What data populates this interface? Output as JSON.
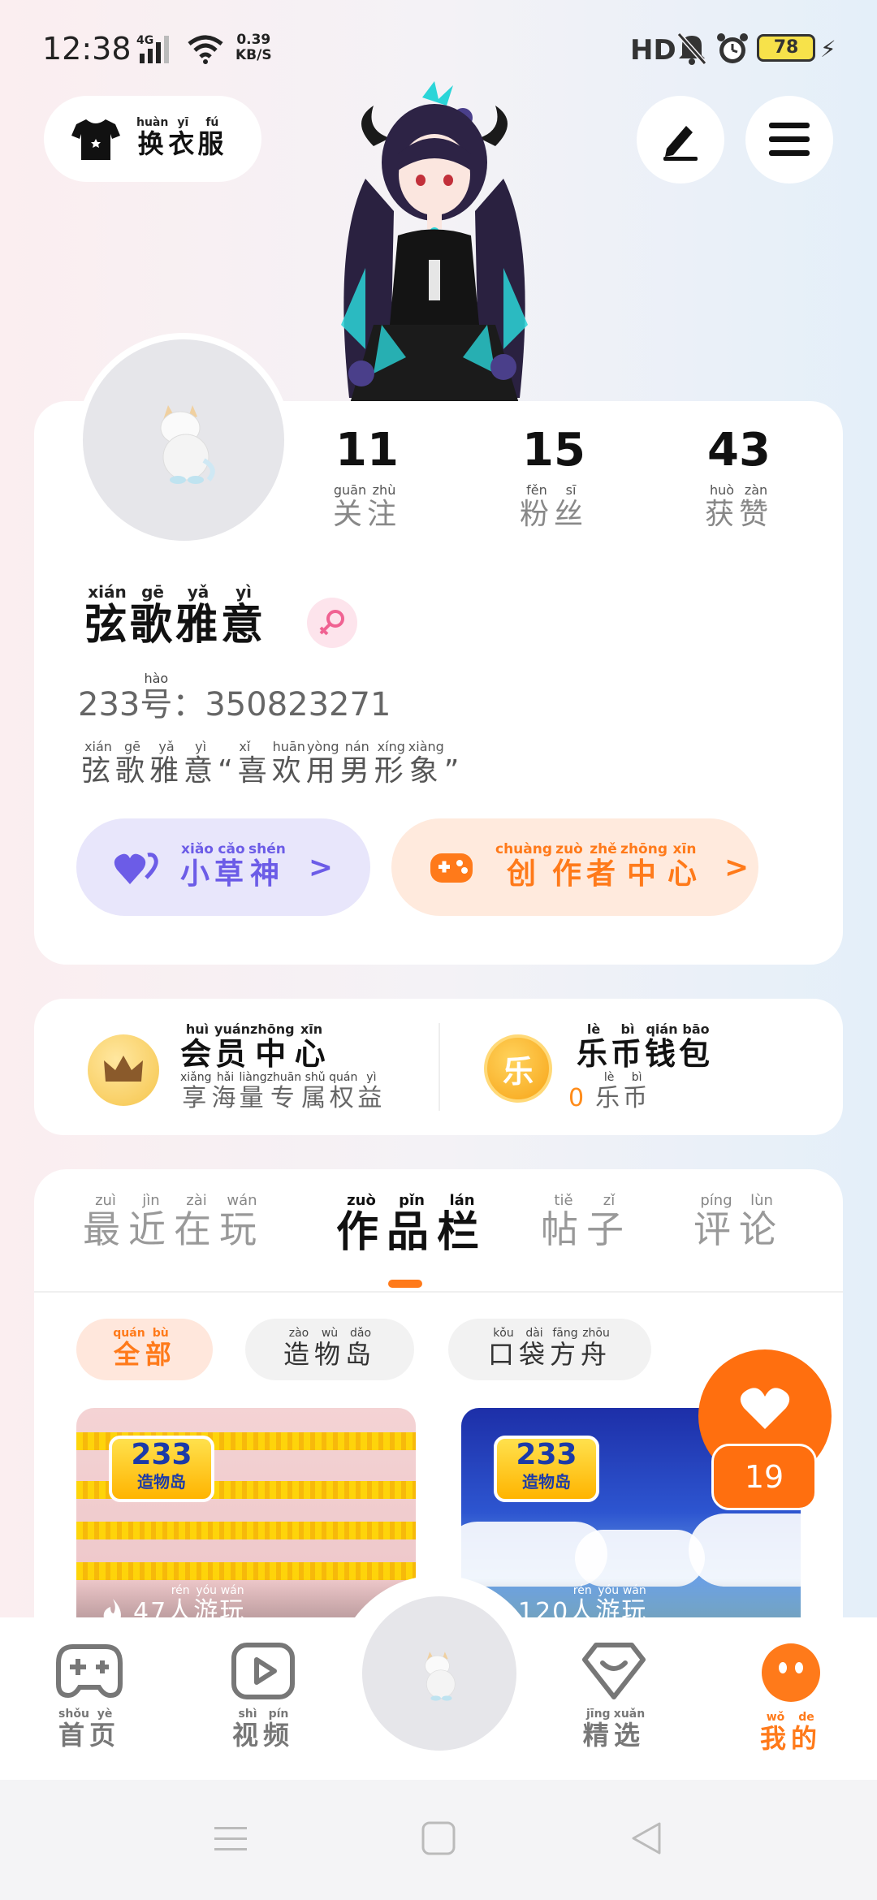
{
  "status_bar": {
    "time": "12:38",
    "network": "4G",
    "speed_value": "0.39",
    "speed_unit": "KB/S",
    "hd": "HD",
    "battery": "78"
  },
  "top": {
    "dress_label": "换衣服",
    "dress_pinyin": [
      "huàn",
      "yī",
      "fú"
    ]
  },
  "profile": {
    "stats": [
      {
        "value": "11",
        "label": [
          "关",
          "注"
        ],
        "pinyin": [
          "guān",
          "zhù"
        ]
      },
      {
        "value": "15",
        "label": [
          "粉",
          "丝"
        ],
        "pinyin": [
          "fěn",
          "sī"
        ]
      },
      {
        "value": "43",
        "label": [
          "获",
          "赞"
        ],
        "pinyin": [
          "huò",
          "zàn"
        ]
      }
    ],
    "username_chars": [
      "弦",
      "歌",
      "雅",
      "意"
    ],
    "username_pinyin": [
      "xián",
      "gē",
      "yǎ",
      "yì"
    ],
    "uid_prefix": "233",
    "uid_hao": "号",
    "uid_hao_pinyin": "hào",
    "uid_sep": "：",
    "uid_value": "350823271",
    "bio_chars": [
      "弦",
      "歌",
      "雅",
      "意",
      "“喜",
      "欢",
      "用",
      "男",
      "形",
      "象",
      "”"
    ],
    "bio_pinyin": [
      "xián",
      "gē",
      "yǎ",
      "yì",
      "xǐ",
      "huān",
      "yòng",
      "nán",
      "xíng",
      "xiàng",
      ""
    ],
    "btn_xzs": [
      "小",
      "草",
      "神"
    ],
    "btn_xzs_pinyin": [
      "xiǎo",
      "cǎo",
      "shén"
    ],
    "btn_creator": [
      "创",
      "作",
      "者",
      "中",
      "心"
    ],
    "btn_creator_pinyin": [
      "chuàng",
      "zuò",
      "zhě",
      "zhōng",
      "xīn"
    ],
    "chevron": ">"
  },
  "member": {
    "vip_title": [
      "会",
      "员",
      "中",
      "心"
    ],
    "vip_title_pinyin": [
      "huì",
      "yuán",
      "zhōng",
      "xīn"
    ],
    "vip_sub": [
      "享",
      "海",
      "量",
      "专",
      "属",
      "权",
      "益"
    ],
    "vip_sub_pinyin": [
      "xiǎng",
      "hǎi",
      "liàng",
      "zhuān",
      "shǔ",
      "quán",
      "yì"
    ],
    "coin_icon": "乐",
    "coin_title": [
      "乐",
      "币",
      "钱",
      "包"
    ],
    "coin_title_pinyin": [
      "lè",
      "bì",
      "qián",
      "bāo"
    ],
    "coin_balance": "0",
    "coin_unit": [
      "乐",
      "币"
    ],
    "coin_unit_pinyin": [
      "lè",
      "bì"
    ]
  },
  "works": {
    "tabs": [
      {
        "chars": [
          "最",
          "近",
          "在",
          "玩"
        ],
        "pinyin": [
          "zuì",
          "jìn",
          "zài",
          "wán"
        ]
      },
      {
        "chars": [
          "作",
          "品",
          "栏"
        ],
        "pinyin": [
          "zuò",
          "pǐn",
          "lán"
        ]
      },
      {
        "chars": [
          "帖",
          "子"
        ],
        "pinyin": [
          "tiě",
          "zǐ"
        ]
      },
      {
        "chars": [
          "评",
          "论"
        ],
        "pinyin": [
          "píng",
          "lùn"
        ]
      }
    ],
    "chips": [
      {
        "chars": [
          "全",
          "部"
        ],
        "pinyin": [
          "quán",
          "bù"
        ]
      },
      {
        "chars": [
          "造",
          "物",
          "岛"
        ],
        "pinyin": [
          "zào",
          "wù",
          "dǎo"
        ]
      },
      {
        "chars": [
          "口",
          "袋",
          "方",
          "舟"
        ],
        "pinyin": [
          "kǒu",
          "dài",
          "fāng",
          "zhōu"
        ]
      }
    ],
    "items": [
      {
        "logo_num": "233",
        "logo_text": "造物岛",
        "players": "47",
        "players_unit": [
          "人",
          "游",
          "玩"
        ],
        "players_pinyin": [
          "rén",
          "yóu",
          "wán"
        ]
      },
      {
        "logo_num": "233",
        "logo_text": "造物岛",
        "players": "120",
        "players_unit": [
          "人",
          "游",
          "玩"
        ],
        "players_pinyin": [
          "rén",
          "yóu",
          "wán"
        ]
      }
    ],
    "like_count": "19"
  },
  "nav": [
    {
      "chars": [
        "首",
        "页"
      ],
      "pinyin": [
        "shǒu",
        "yè"
      ]
    },
    {
      "chars": [
        "视",
        "频"
      ],
      "pinyin": [
        "shì",
        "pín"
      ]
    },
    {
      "chars": [
        "精",
        "选"
      ],
      "pinyin": [
        "jīng",
        "xuǎn"
      ]
    },
    {
      "chars": [
        "我",
        "的"
      ],
      "pinyin": [
        "wǒ",
        "de"
      ]
    }
  ],
  "colors": {
    "accent": "#ff7a1a",
    "purple": "#6c5ce7"
  }
}
